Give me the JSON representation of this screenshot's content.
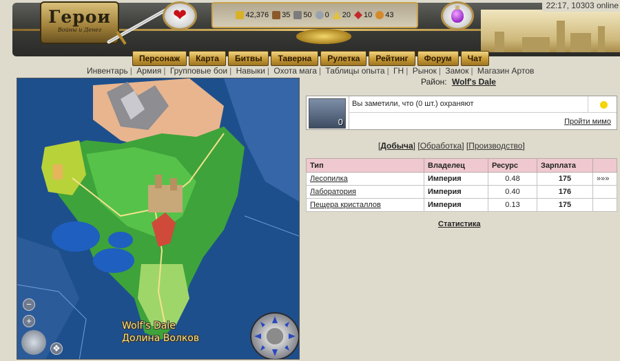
{
  "header": {
    "logo_title": "Герои",
    "logo_subtitle": "Войны и Денег",
    "clock": "22:17, 10303 online",
    "resources": [
      {
        "icon": "gold-icon",
        "value": "42,376",
        "color": "#d8b12a"
      },
      {
        "icon": "wood-icon",
        "value": "35",
        "color": "#8a5a2a"
      },
      {
        "icon": "ore-icon",
        "value": "50",
        "color": "#7c7c7c"
      },
      {
        "icon": "mercury-icon",
        "value": "0",
        "color": "#9aa3ad"
      },
      {
        "icon": "sulfur-icon",
        "value": "20",
        "color": "#e2c23a"
      },
      {
        "icon": "crystals-icon",
        "value": "10",
        "color": "#c22b2b"
      },
      {
        "icon": "gems-icon",
        "value": "43",
        "color": "#d48a2a"
      }
    ]
  },
  "nav": {
    "main": [
      "Персонаж",
      "Карта",
      "Битвы",
      "Таверна",
      "Рулетка",
      "Рейтинг",
      "Форум",
      "Чат"
    ],
    "sub": [
      "Инвентарь",
      "Армия",
      "Групповые бои",
      "Навыки",
      "Охота мага",
      "Таблицы опыта",
      "ГН",
      "Рынок",
      "Замок",
      "Магазин Артов"
    ]
  },
  "map": {
    "label_en": "Wolf's Dale",
    "label_ru": "Долина Волков"
  },
  "district": {
    "label": "Район:",
    "name": "Wolf's Dale"
  },
  "guard": {
    "message": "Вы заметили, что (0 шт.) охраняют",
    "count": "0",
    "pass_link": "Пройти мимо"
  },
  "tabs": {
    "open": "[",
    "tab1": "Добыча",
    "mid1": "] [",
    "tab2": "Обработка",
    "mid2": "] [",
    "tab3": "Производство",
    "close": "]"
  },
  "table": {
    "headers": [
      "Тип",
      "Владелец",
      "Ресурс",
      "Зарплата",
      ""
    ],
    "rows": [
      {
        "type": "Лесопилка",
        "owner": "Империя",
        "resource": "0.48",
        "salary": "175",
        "action": "»»»"
      },
      {
        "type": "Лаборатория",
        "owner": "Империя",
        "resource": "0.40",
        "salary": "176",
        "action": ""
      },
      {
        "type": "Пещера кристаллов",
        "owner": "Империя",
        "resource": "0.13",
        "salary": "175",
        "action": ""
      }
    ]
  },
  "stats_link": "Статистика"
}
